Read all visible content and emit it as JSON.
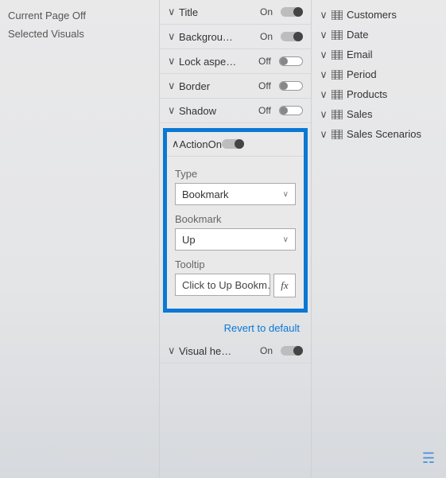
{
  "left": {
    "currentPage": "Current Page Off",
    "selectedVisuals": "Selected Visuals"
  },
  "format": {
    "rows": [
      {
        "label": "Title",
        "state": "On",
        "on": true
      },
      {
        "label": "Backgrou…",
        "state": "On",
        "on": true
      },
      {
        "label": "Lock aspe…",
        "state": "Off",
        "on": false
      },
      {
        "label": "Border",
        "state": "Off",
        "on": false
      },
      {
        "label": "Shadow",
        "state": "Off",
        "on": false
      }
    ],
    "action": {
      "header": "Action",
      "state": "On",
      "typeLabel": "Type",
      "typeValue": "Bookmark",
      "bookmarkLabel": "Bookmark",
      "bookmarkValue": "Up",
      "tooltipLabel": "Tooltip",
      "tooltipValue": "Click to Up Bookm…",
      "fx": "fx"
    },
    "revert": "Revert to default",
    "visualHeader": {
      "label": "Visual he…",
      "state": "On"
    }
  },
  "fields": [
    "Customers",
    "Date",
    "Email",
    "Period",
    "Products",
    "Sales",
    "Sales Scenarios"
  ]
}
